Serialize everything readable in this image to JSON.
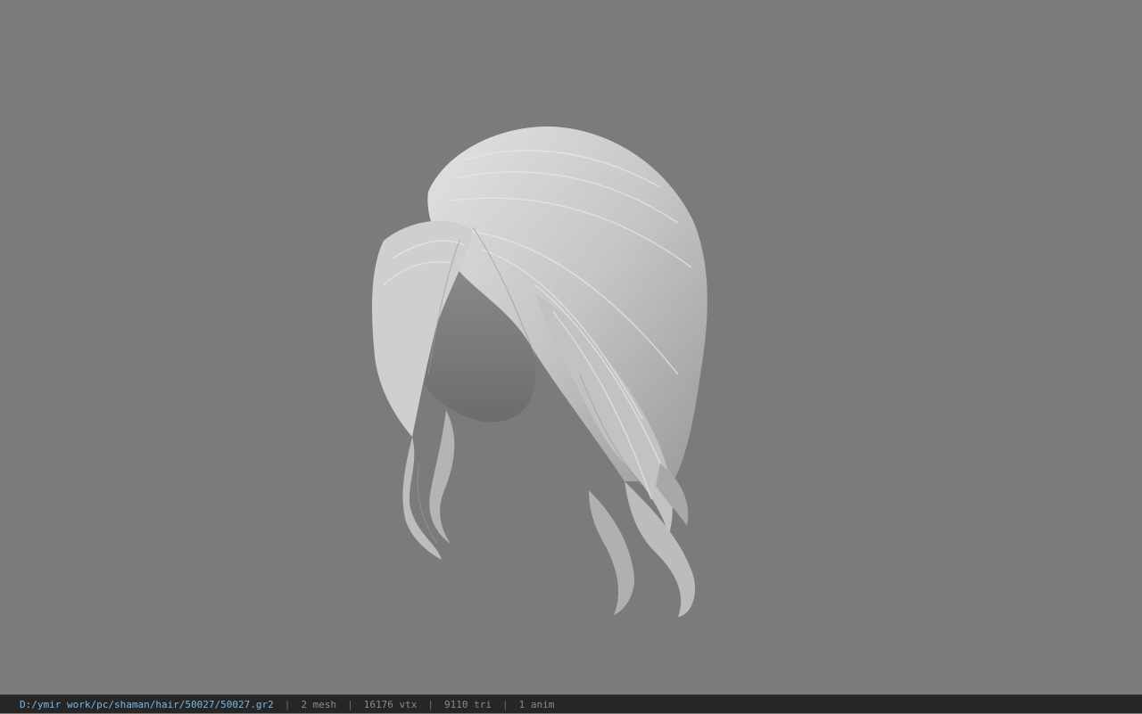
{
  "viewport": {
    "background_color": "#7b7b7b",
    "model_color": "#c9c9c9",
    "model_subject": "hair-model"
  },
  "statusbar": {
    "file_path": "D:/ymir work/pc/shaman/hair/50027/50027.gr2",
    "separator": "|",
    "mesh_count": "2 mesh",
    "vertex_count": "16176 vtx",
    "triangle_count": "9110 tri",
    "anim_count": "1 anim",
    "path_color": "#79b8e6"
  }
}
